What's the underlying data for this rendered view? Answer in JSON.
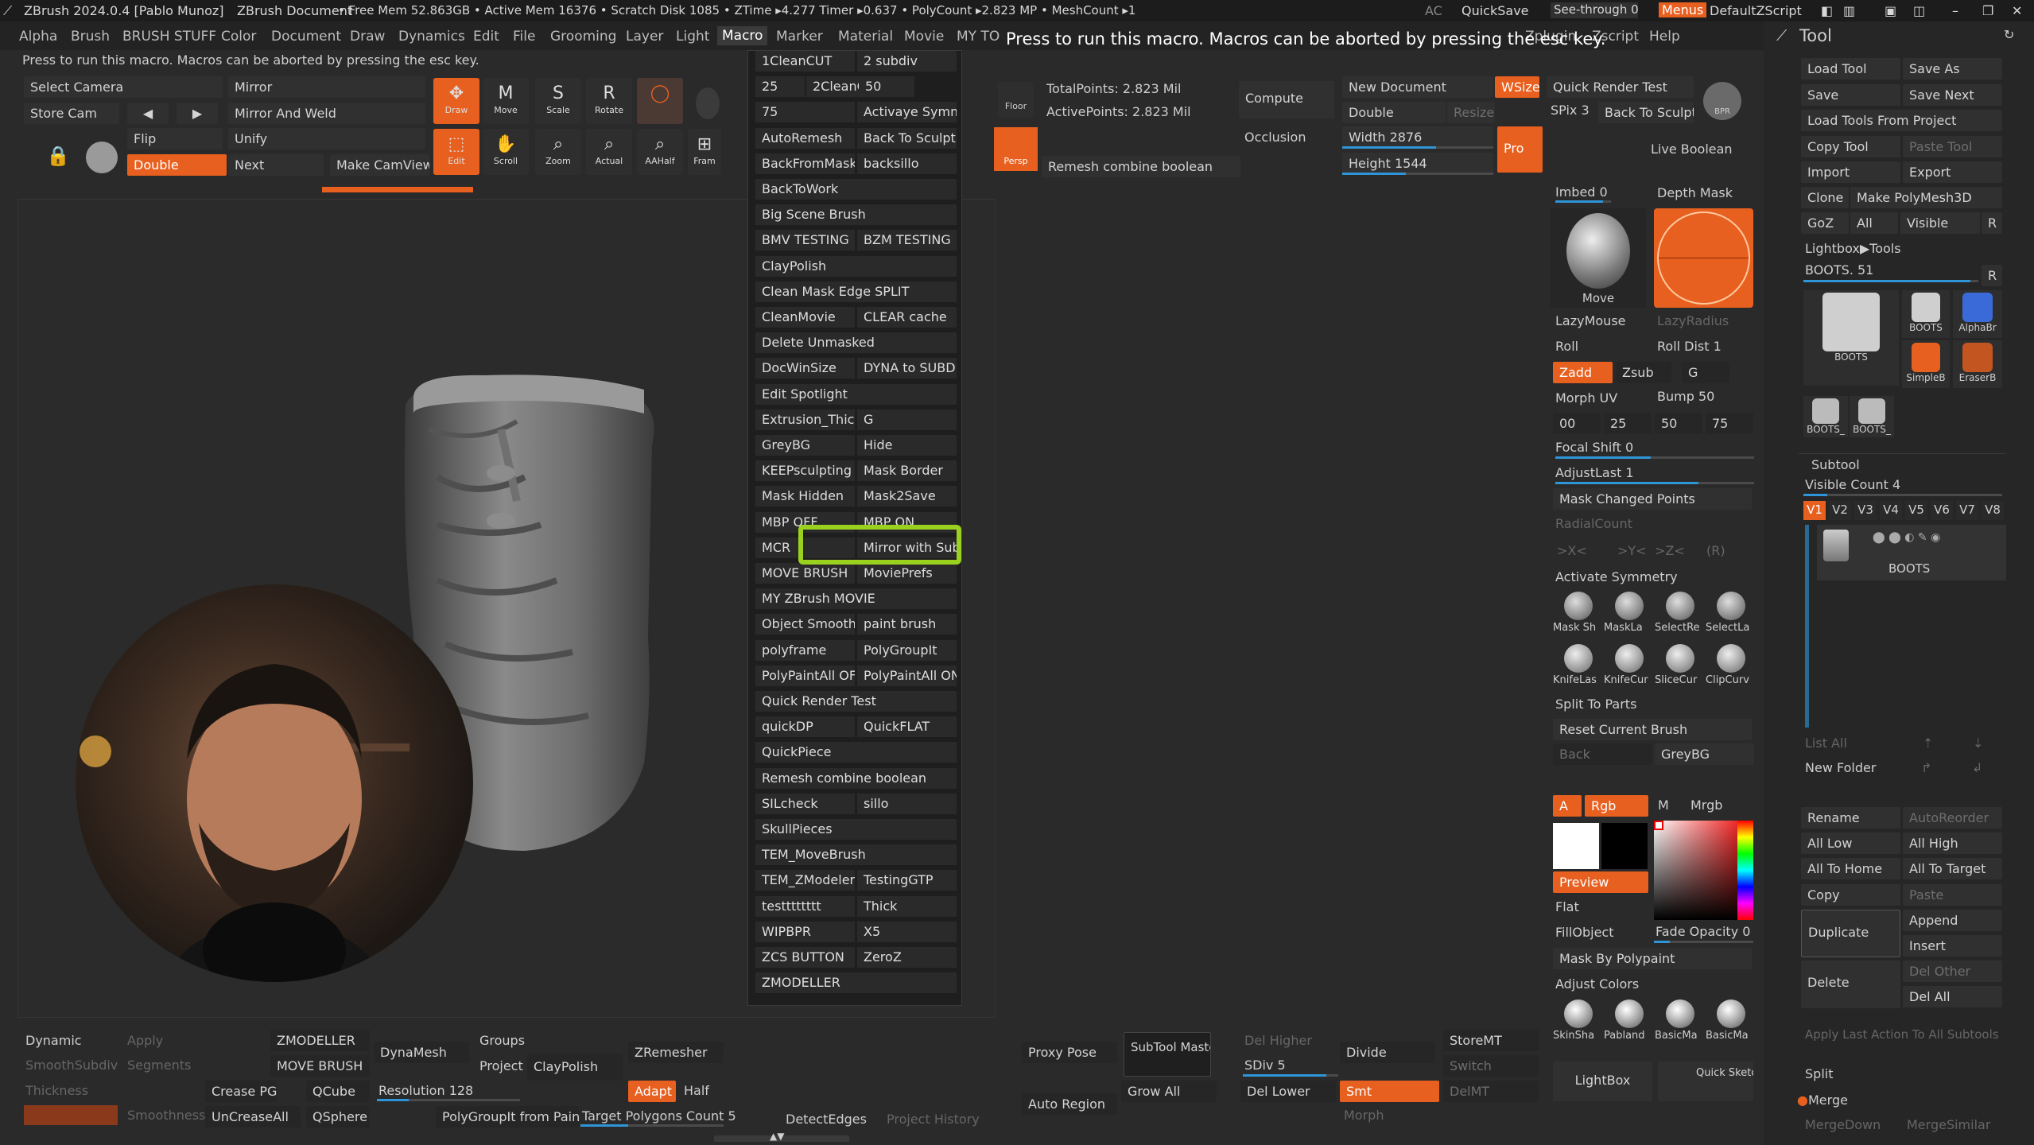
{
  "titlebar": {
    "app": "ZBrush 2024.0.4 [Pablo Munoz]",
    "doc": "ZBrush Document",
    "stats": "• Free Mem 52.863GB • Active Mem 16376 • Scratch Disk 1085 • ZTime ▸4.277 Timer ▸0.637 • PolyCount ▸2.823 MP • MeshCount ▸1",
    "ac": "AC",
    "quicksave": "QuickSave",
    "seethrough": "See-through  0",
    "menus": "Menus",
    "defaultzscript": "DefaultZScript"
  },
  "menubar": [
    "Alpha",
    "Brush",
    "BRUSH STUFF",
    "Color",
    "Document",
    "Draw",
    "Dynamics",
    "Edit",
    "File",
    "Grooming",
    "Layer",
    "Light",
    "Macro",
    "Marker",
    "Material",
    "Movie",
    "MY TO",
    "Zplugin",
    "Zscript",
    "Help"
  ],
  "hint": "Press to run this macro. Macros can be aborted by pressing the esc key.",
  "tooltip": "Press to run this macro. Macros can be aborted by pressing the esc key.",
  "left_tools": {
    "select_camera": "Select Camera",
    "store_cam": "Store Cam",
    "mirror": "Mirror",
    "mirror_weld": "Mirror And Weld",
    "flip": "Flip",
    "unify": "Unify",
    "double": "Double",
    "next": "Next",
    "make_camview": "Make CamView"
  },
  "transform_tools": {
    "draw": "Draw",
    "move": "Move",
    "scale": "Scale",
    "rotate": "Rotate",
    "edit": "Edit",
    "scroll": "Scroll",
    "zoom": "Zoom",
    "actual": "Actual",
    "aahalf": "AAHalf",
    "frame": "Fram"
  },
  "macros": [
    [
      "1CleanCUT",
      "2 subdiv"
    ],
    [
      "25",
      "2CleanCUT",
      "50"
    ],
    [
      "75",
      "Activaye Symmetry"
    ],
    [
      "AutoRemesh",
      "Back To Sculpt"
    ],
    [
      "BackFromMask",
      "backsillo"
    ],
    [
      "BackToWork"
    ],
    [
      "Big Scene Brush"
    ],
    [
      "BMV TESTING",
      "BZM TESTING"
    ],
    [
      "ClayPolish"
    ],
    [
      "Clean Mask Edge SPLIT"
    ],
    [
      "CleanMovie",
      "CLEAR cache"
    ],
    [
      "Delete Unmasked"
    ],
    [
      "DocWinSize",
      "DYNA to SUBD"
    ],
    [
      "Edit Spotlight"
    ],
    [
      "Extrusion_Thickness",
      "G"
    ],
    [
      "GreyBG",
      "Hide"
    ],
    [
      "KEEPsculpting",
      "Mask Border"
    ],
    [
      "Mask Hidden",
      "Mask2Save"
    ],
    [
      "MBP OFF",
      "MBP ON"
    ],
    [
      "MCR",
      "Mirror with Subdiv"
    ],
    [
      "MOVE BRUSH",
      "MoviePrefs"
    ],
    [
      "MY ZBrush MOVIE"
    ],
    [
      "Object Smooth",
      "paint brush"
    ],
    [
      "polyframe",
      "PolyGroupIt"
    ],
    [
      "PolyPaintAll OFF",
      "PolyPaintAll ON"
    ],
    [
      "Quick Render Test"
    ],
    [
      "quickDP",
      "QuickFLAT"
    ],
    [
      "QuickPiece"
    ],
    [
      "Remesh combine boolean"
    ],
    [
      "SILcheck",
      "sillo"
    ],
    [
      "SkullPieces"
    ],
    [
      "TEM_MoveBrush"
    ],
    [
      "TEM_ZModeler",
      "TestingGTP"
    ],
    [
      "testttttttt",
      "Thick"
    ],
    [
      "WIPBPR",
      "X5"
    ],
    [
      "ZCS BUTTON",
      "ZeroZ"
    ],
    [
      "ZMODELLER"
    ]
  ],
  "top_right": {
    "floor": "Floor",
    "persp": "Persp",
    "total_points": "TotalPoints: 2.823 Mil",
    "active_points": "ActivePoints: 2.823 Mil",
    "compute": "Compute",
    "occlusion": "Occlusion",
    "new_document": "New Document",
    "wsize": "WSize",
    "double": "Double",
    "resize": "Resize",
    "width": "Width 2876",
    "height": "Height 1544",
    "pro": "Pro",
    "remesh_combine": "Remesh combine boolean",
    "quick_render": "Quick Render Test",
    "spix": "SPix 3",
    "back_to_sculpt": "Back To Sculpt",
    "bpr": "BPR",
    "live_boolean": "Live Boolean"
  },
  "mid_right": {
    "imbed": "Imbed 0",
    "depth_mask": "Depth Mask",
    "move": "Move",
    "lazymouse": "LazyMouse",
    "lazyradius": "LazyRadius",
    "roll": "Roll",
    "roll_dist": "Roll Dist 1",
    "zadd": "Zadd",
    "zsub": "Zsub",
    "g": "G",
    "morph_uv": "Morph UV",
    "bump": "Bump 50",
    "vals": [
      "00",
      "25",
      "50",
      "75"
    ],
    "focal_shift": "Focal Shift 0",
    "adjust_last": "AdjustLast 1",
    "mask_changed": "Mask Changed Points",
    "radial_count": "RadialCount",
    "xyz": [
      ">X<",
      ">Y<",
      ">Z<",
      "(R)"
    ],
    "activate_symmetry": "Activate Symmetry",
    "mask_icons": [
      "Mask Sh",
      "MaskLa",
      "SelectRe",
      "SelectLa"
    ],
    "knife_icons": [
      "KnifeLas",
      "KnifeCur",
      "SliceCur",
      "ClipCurv"
    ],
    "split_to_parts": "Split To Parts",
    "reset_current_brush": "Reset Current Brush",
    "back": "Back",
    "greybg": "GreyBG",
    "a": "A",
    "rgb": "Rgb",
    "m": "M",
    "mrgb": "Mrgb",
    "preview": "Preview",
    "flat": "Flat",
    "fillobject": "FillObject",
    "fade_opacity": "Fade Opacity 0",
    "mask_by_polypaint": "Mask By Polypaint",
    "adjust_colors": "Adjust Colors",
    "materials": [
      "SkinSha",
      "Pabland",
      "BasicMa",
      "BasicMa"
    ],
    "lightbox": "LightBox",
    "quick_sketch": "Quick Sketch"
  },
  "tool_panel": {
    "title": "Tool",
    "load_tool": "Load Tool",
    "save_as": "Save As",
    "save": "Save",
    "save_next": "Save Next",
    "load_from_project": "Load Tools From Project",
    "copy_tool": "Copy Tool",
    "paste_tool": "Paste Tool",
    "import": "Import",
    "export": "Export",
    "clone": "Clone",
    "make_polymesh": "Make PolyMesh3D",
    "goz": "GoZ",
    "all": "All",
    "visible": "Visible",
    "r": "R",
    "lightbox_tools": "Lightbox▶Tools",
    "boots_slider": "BOOTS. 51",
    "thumbs": [
      "BOOTS",
      "BOOTS",
      "AlphaBr",
      "SimpleB",
      "EraserB",
      "BOOTS_",
      "BOOTS_"
    ],
    "subtool": "Subtool",
    "visible_count": "Visible Count 4",
    "versions": [
      "V1",
      "V2",
      "V3",
      "V4",
      "V5",
      "V6",
      "V7",
      "V8"
    ],
    "subtool_name": "BOOTS",
    "list_all": "List All",
    "new_folder": "New Folder",
    "rename": "Rename",
    "autoreorder": "AutoReorder",
    "all_low": "All Low",
    "all_high": "All High",
    "all_to_home": "All To Home",
    "all_to_target": "All To Target",
    "copy": "Copy",
    "paste": "Paste",
    "duplicate": "Duplicate",
    "append": "Append",
    "insert": "Insert",
    "delete": "Delete",
    "del_other": "Del Other",
    "del_all": "Del All",
    "apply_last": "Apply Last Action To All Subtools",
    "split": "Split",
    "merge": "Merge",
    "mergedown": "MergeDown",
    "mergesimilar": "MergeSimilar"
  },
  "bottom": {
    "dynamic": "Dynamic",
    "apply": "Apply",
    "smoothsubdiv": "SmoothSubdiv",
    "segments": "Segments",
    "thickness": "Thickness",
    "smoothness": "Smoothness",
    "zmodeller": "ZMODELLER",
    "move_brush": "MOVE BRUSH",
    "crease_pg": "Crease PG",
    "qcube": "QCube",
    "uncreaseall": "UnCreaseAll",
    "qsphere": "QSphere",
    "dynamesh": "DynaMesh",
    "groups": "Groups",
    "project": "Project",
    "claypolish": "ClayPolish",
    "resolution": "Resolution 128",
    "zremesher": "ZRemesher",
    "adapt": "Adapt",
    "half": "Half",
    "polygroupit_paint": "PolyGroupIt from Paint",
    "target_polygons": "Target Polygons Count 5",
    "detect_edges": "DetectEdges",
    "project_history": "Project History",
    "proxy_pose": "Proxy Pose",
    "subtool_master": "SubTool Master",
    "auto_region": "Auto Region",
    "del_higher": "Del Higher",
    "sdiv": "SDiv 5",
    "del_lower": "Del Lower",
    "grow_all": "Grow All",
    "divide": "Divide",
    "smt": "Smt",
    "storemt": "StoreMT",
    "switch": "Switch",
    "delmt": "DelMT",
    "morph": "Morph"
  },
  "colors": {
    "accent": "#e8601f",
    "highlight": "#9ad11e",
    "slider": "#2e96d8"
  }
}
